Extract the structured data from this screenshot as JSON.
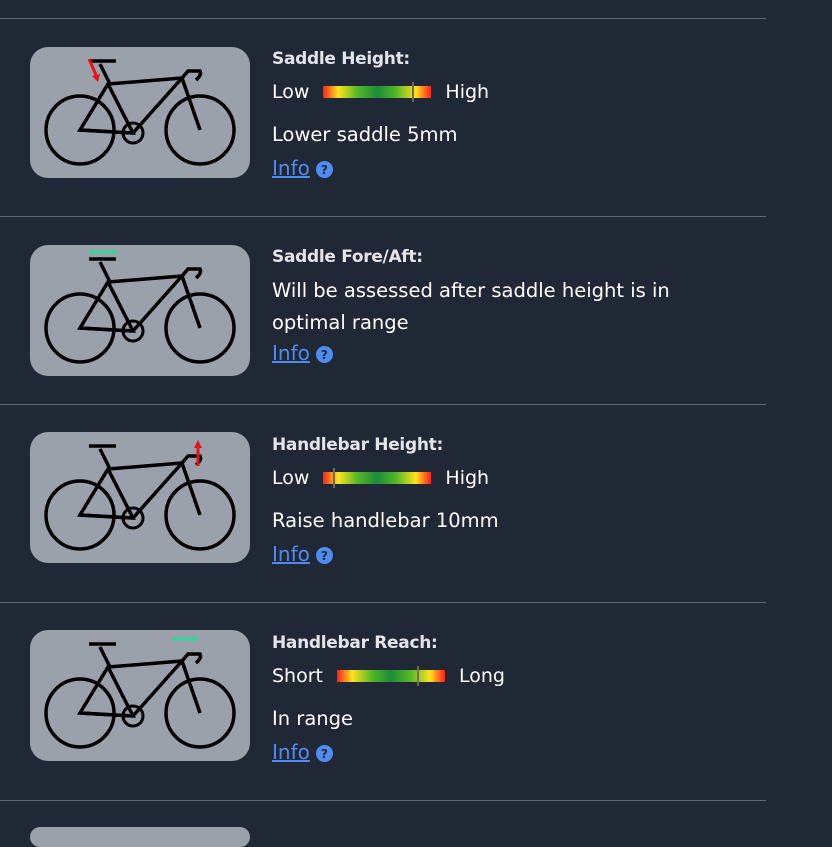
{
  "sections": [
    {
      "label": "Saddle Height:",
      "left_label": "Low",
      "right_label": "High",
      "position": 0.84,
      "message": "Lower saddle 5mm",
      "info_label": "Info",
      "indicator": "saddle-down-arrow"
    },
    {
      "label": "Saddle Fore/Aft:",
      "message": "Will be assessed after saddle height is in optimal range",
      "info_label": "Info",
      "indicator": "saddle-horizontal-marker"
    },
    {
      "label": "Handlebar Height:",
      "left_label": "Low",
      "right_label": "High",
      "position": 0.09,
      "message": "Raise handlebar 10mm",
      "info_label": "Info",
      "indicator": "handlebar-up-arrow"
    },
    {
      "label": "Handlebar Reach:",
      "left_label": "Short",
      "right_label": "Long",
      "position": 0.75,
      "message": "In range",
      "info_label": "Info",
      "indicator": "handlebar-reach-marker"
    }
  ],
  "colors": {
    "background": "#202836",
    "card": "#9ba1ab",
    "link": "#4f8cf2",
    "arrow_red": "#e8121c",
    "marker_green": "#34d399"
  }
}
